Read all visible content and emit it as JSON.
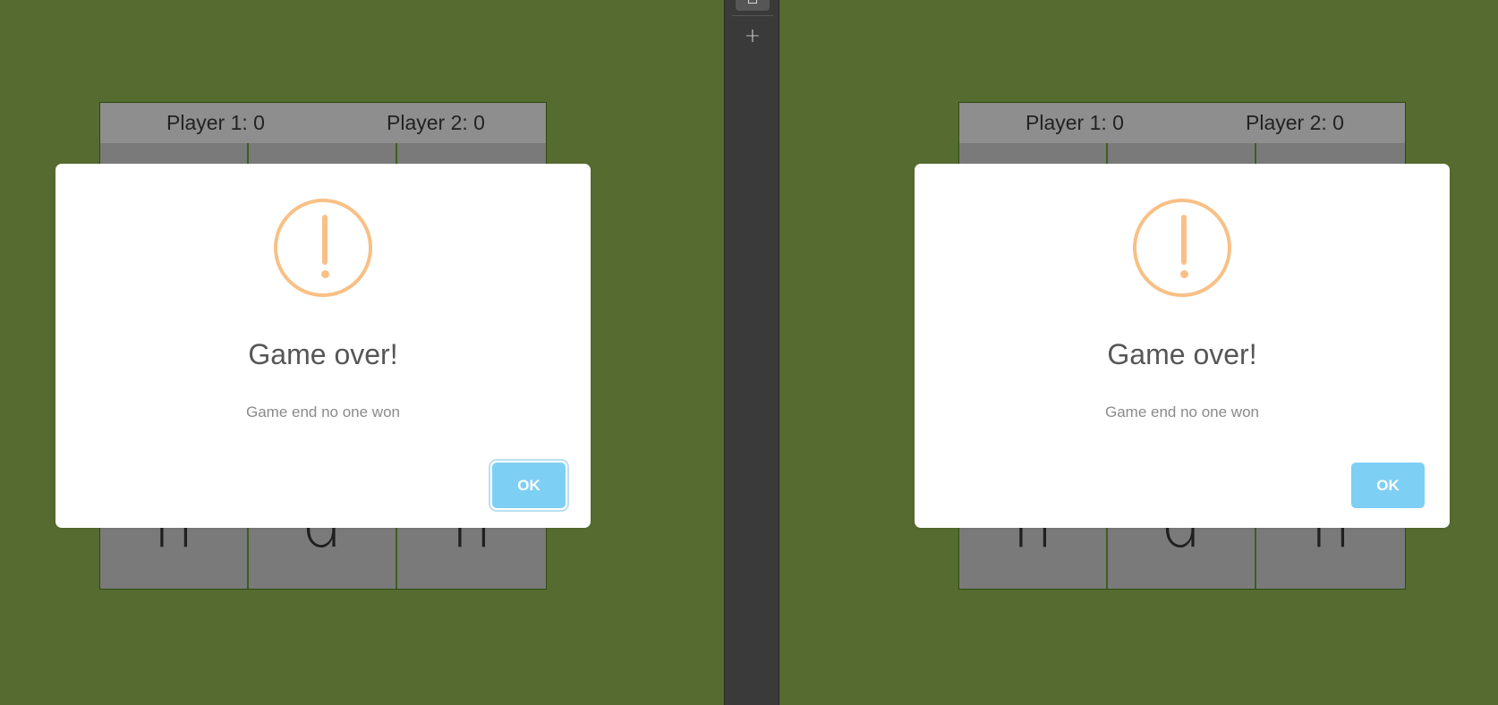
{
  "panes": [
    {
      "scores": {
        "player1": "Player 1: 0",
        "player2": "Player 2: 0"
      },
      "cells": [
        "",
        "",
        "",
        "",
        "",
        "",
        "n",
        "d",
        "n"
      ],
      "modal": {
        "icon": "warning-icon",
        "title": "Game over!",
        "text": "Game end no one won",
        "ok_label": "OK",
        "ok_focused": true
      }
    },
    {
      "scores": {
        "player1": "Player 1: 0",
        "player2": "Player 2: 0"
      },
      "cells": [
        "",
        "",
        "",
        "",
        "",
        "",
        "n",
        "d",
        "n"
      ],
      "modal": {
        "icon": "warning-icon",
        "title": "Game over!",
        "text": "Game end no one won",
        "ok_label": "OK",
        "ok_focused": false
      }
    }
  ],
  "divider": {
    "plus_label": "+"
  },
  "colors": {
    "background": "#556b2f",
    "board": "#7a7a7a",
    "scorebar": "#8e8e8e",
    "warning": "#f8c086",
    "button": "#7ecff4"
  }
}
